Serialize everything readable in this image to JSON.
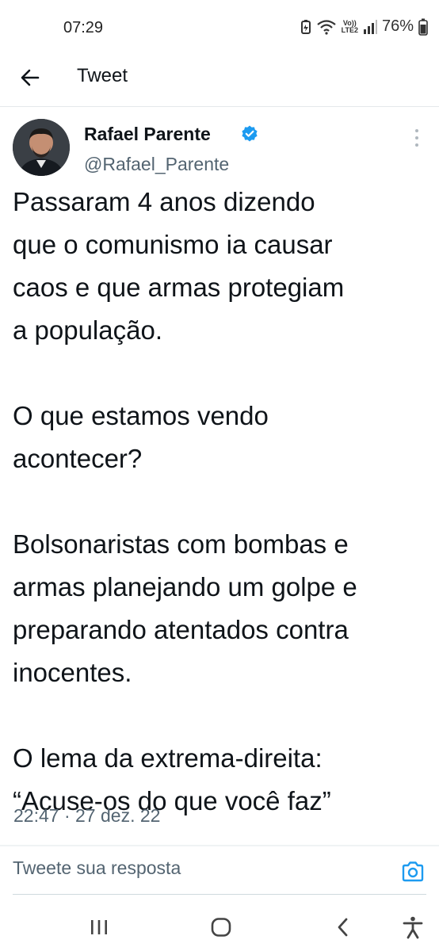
{
  "status_bar": {
    "time": "07:29",
    "network_label_top": "Vo))",
    "network_label_bottom": "LTE2",
    "battery": "76%"
  },
  "header": {
    "title": "Tweet",
    "back_icon": "arrow-left-icon"
  },
  "tweet": {
    "author_name": "Rafael Parente",
    "author_handle": "@Rafael_Parente",
    "verified": true,
    "text": "Passaram 4 anos dizendo\nque o comunismo ia causar\ncaos e que armas protegiam\na população.\n\nO que estamos vendo\nacontecer?\n\nBolsonaristas com bombas e\narmas planejando um golpe e\npreparando atentados contra\ninocentes.\n\nO lema da extrema-direita:\n“Acuse-os do que você faz”",
    "time": "22:47",
    "separator": "·",
    "date": "27 dez. 22"
  },
  "reply": {
    "placeholder": "Tweete sua resposta",
    "camera_icon": "camera-icon"
  },
  "colors": {
    "accent": "#1d9bf0",
    "text": "#0f1419",
    "secondary": "#536471"
  },
  "nav_bar": [
    "recent-apps-icon",
    "home-icon",
    "back-icon",
    "accessibility-icon"
  ]
}
